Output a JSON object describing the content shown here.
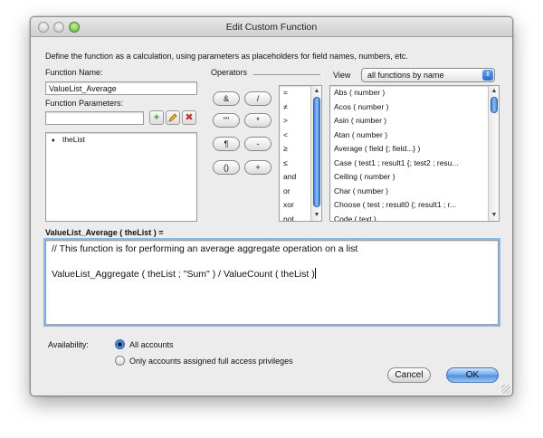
{
  "window": {
    "title": "Edit Custom Function",
    "instructions": "Define the function as a calculation, using parameters as placeholders for field names, numbers, etc."
  },
  "function_name": {
    "label": "Function Name:",
    "value": "ValueList_Average"
  },
  "function_parameters": {
    "label": "Function Parameters:",
    "input_value": "",
    "items": [
      {
        "marker": "♦",
        "name": "theList"
      }
    ]
  },
  "operators": {
    "label": "Operators",
    "buttons": [
      "&",
      "/",
      "\"\"",
      "*",
      "¶",
      "-",
      "()",
      "+"
    ],
    "list": [
      "=",
      "≠",
      ">",
      "<",
      "≥",
      "≤",
      "and",
      "or",
      "xor",
      "not"
    ]
  },
  "view": {
    "label": "View",
    "selected": "all functions by name",
    "functions": [
      "Abs ( number )",
      "Acos ( number )",
      "Asin ( number )",
      "Atan ( number )",
      "Average ( field {; field...} )",
      "Case ( test1 ; result1 {; test2 ; resu...",
      "Ceiling ( number )",
      "Char ( number )",
      "Choose ( test ; result0 {; result1 ; r...",
      "Code ( text )"
    ]
  },
  "calculation": {
    "signature": "ValueList_Average ( theList ) =",
    "lines": [
      "// This function is for performing an average aggregate operation on a list",
      "",
      "ValueList_Aggregate ( theList ; \"Sum\" ) / ValueCount ( theList )"
    ]
  },
  "availability": {
    "label": "Availability:",
    "options": [
      {
        "label": "All accounts",
        "selected": true
      },
      {
        "label": "Only accounts assigned full access privileges",
        "selected": false
      }
    ]
  },
  "buttons": {
    "cancel": "Cancel",
    "ok": "OK"
  },
  "colors": {
    "accent": "#4b8be0",
    "add_green": "#3c9a2a",
    "delete_red": "#c83232"
  }
}
